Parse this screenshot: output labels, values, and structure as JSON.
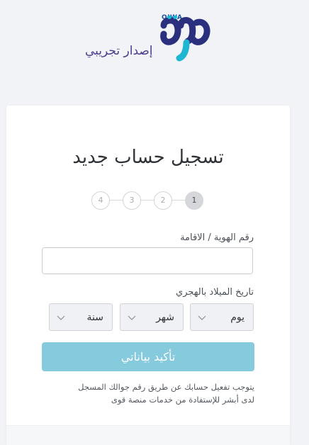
{
  "brand": {
    "latin_name": "QIWA",
    "arabic_mark": "قوى",
    "subtitle": "إصدار تجريبي",
    "colors": {
      "primary": "#2a2f7e",
      "accent": "#1fb6d4"
    }
  },
  "form": {
    "title": "تسجيل حساب جديد",
    "steps": [
      "1",
      "2",
      "3",
      "4"
    ],
    "active_step": 1,
    "id_label": "رقم الهوية / الاقامة",
    "id_value": "",
    "birthdate_label": "تاريخ الميلاد بالهجري",
    "day_select": "يوم",
    "month_select": "شهر",
    "year_select": "سنة",
    "confirm_button": "تأكيد بياناتي",
    "note_line1": "يتوجب تفعيل حسابك عن طريق رقم جوالك المسجل",
    "note_line2": "لدى أبشر للإستفادة من خدمات منصة قوى"
  },
  "colors": {
    "button": "#86cadd",
    "active_step": "#d5d7da",
    "page_bg": "#f2f3f6"
  }
}
